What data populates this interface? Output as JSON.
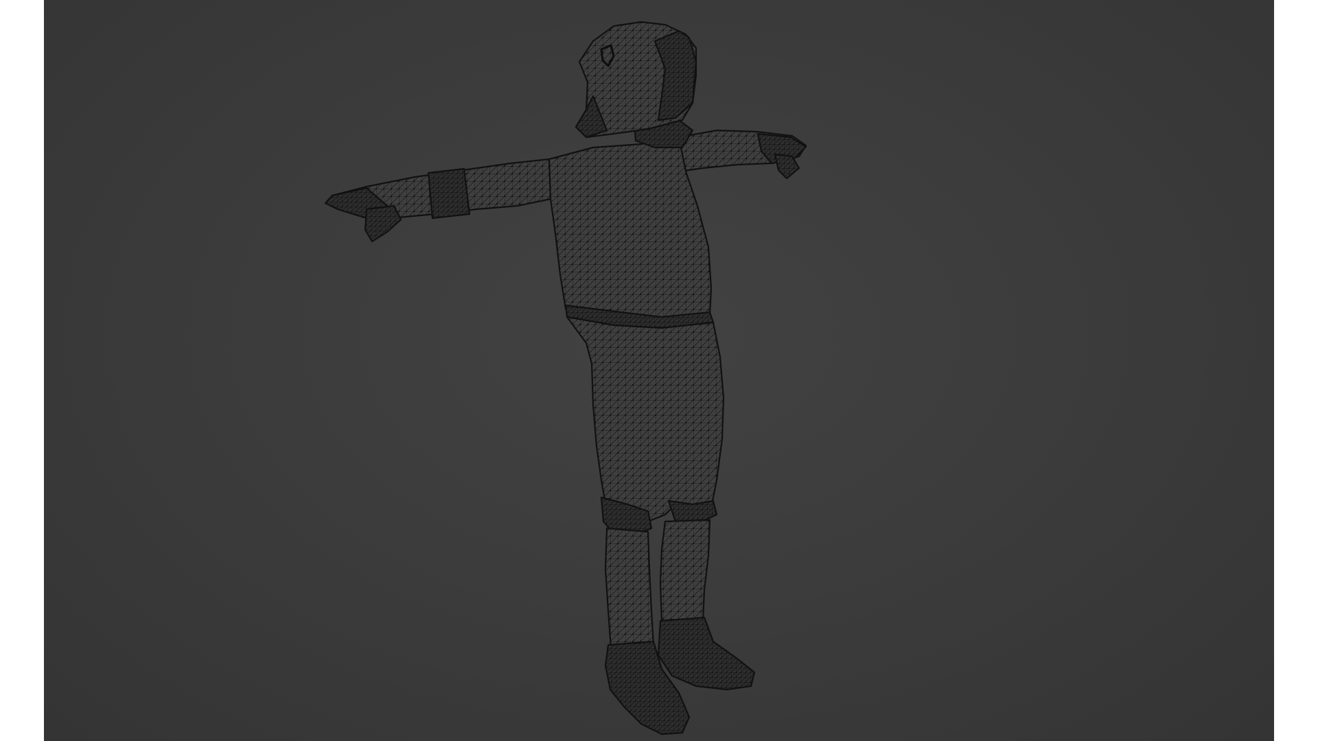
{
  "viewport": {
    "background_color": "#3d3d3d",
    "wire_color": "#1c1c1c",
    "mesh_fill_color": "#3f3f3f",
    "vertex_color": "#0f0f0f",
    "shading_mode": "wireframe",
    "subject": "t-pose-character-mesh"
  }
}
